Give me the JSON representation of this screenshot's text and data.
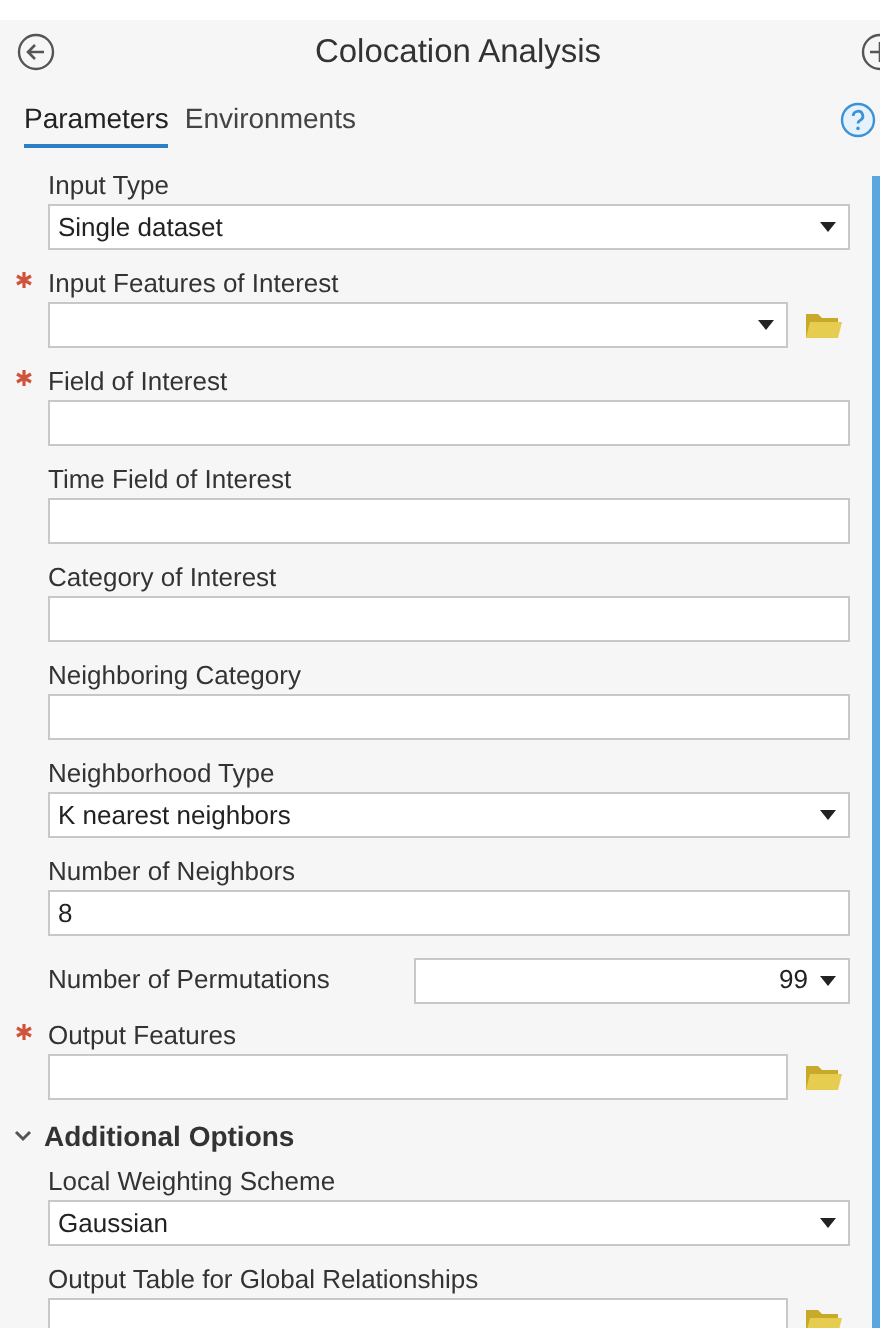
{
  "window": {
    "title": "Colocation Analysis"
  },
  "tabs": [
    {
      "label": "Parameters",
      "selected": true
    },
    {
      "label": "Environments",
      "selected": false
    }
  ],
  "parameters": [
    {
      "label": "Input Type",
      "required": false,
      "kind": "dropdown",
      "value": "Single dataset"
    },
    {
      "label": "Input Features of Interest",
      "required": true,
      "kind": "dropdown",
      "browse": true
    },
    {
      "label": "Field of Interest",
      "required": true,
      "kind": "text"
    },
    {
      "label": "Time Field of Interest",
      "required": false,
      "kind": "text"
    },
    {
      "label": "Category of Interest",
      "required": false,
      "kind": "text"
    },
    {
      "label": "Neighboring Category",
      "required": false,
      "kind": "text"
    },
    {
      "label": "Neighborhood Type",
      "required": false,
      "kind": "dropdown",
      "value": "K nearest neighbors"
    },
    {
      "label": "Number of Neighbors",
      "required": false,
      "kind": "text",
      "value": "8"
    },
    {
      "label": "Number of Permutations",
      "required": false,
      "kind": "inline",
      "value": "99"
    },
    {
      "label": "Output Features",
      "required": true,
      "kind": "text",
      "browse": true
    }
  ],
  "groups": [
    {
      "label": "Additional Options",
      "expanded": true,
      "parameters": [
        {
          "label": "Local Weighting Scheme",
          "required": false,
          "kind": "dropdown",
          "value": "Gaussian"
        },
        {
          "label": "Output Table for Global Relationships",
          "required": false,
          "kind": "text",
          "browse": true
        }
      ]
    }
  ]
}
